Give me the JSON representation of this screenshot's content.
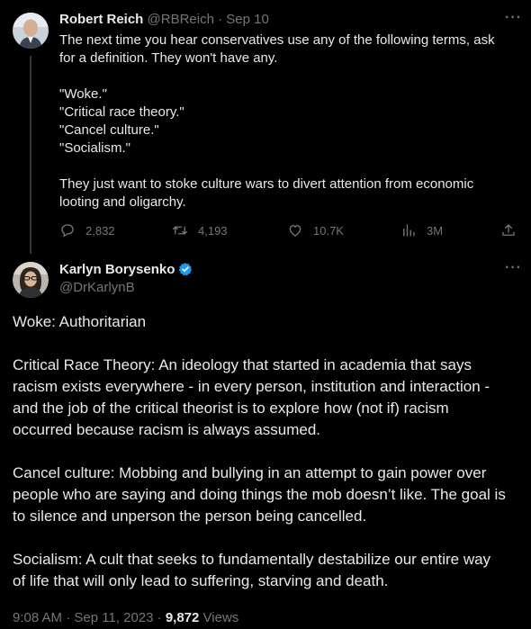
{
  "tweet1": {
    "name": "Robert Reich",
    "handle": "@RBReich",
    "separator": "·",
    "date": "Sep 10",
    "more": "···",
    "text_lines": [
      "The next time you hear conservatives use any of the following terms, ask",
      "for a definition. They won't have any.",
      "",
      "\"Woke.\"",
      "\"Critical race theory.\"",
      "\"Cancel culture.\"",
      "\"Socialism.\"",
      "",
      "They just want to stoke culture wars to divert attention from economic",
      "looting and oligarchy."
    ],
    "replies": "2,832",
    "retweets": "4,193",
    "likes": "10.7K",
    "views": "3M"
  },
  "tweet2": {
    "name": "Karlyn Borysenko",
    "handle": "@DrKarlynB",
    "more": "···",
    "paragraphs": [
      [
        "Woke: Authoritarian"
      ],
      [
        "Critical Race Theory: An ideology that started in academia that says",
        "racism exists everywhere - in every person, institution and interaction -",
        "and the job of the critical theorist is to explore how (not if) racism",
        "occurred because racism is always assumed."
      ],
      [
        "Cancel culture: Mobbing and bullying in an attempt to gain power over",
        "people who are saying and doing things the mob doesn’t like. The goal is",
        "to silence and unperson the person being cancelled."
      ],
      [
        "Socialism: A cult that seeks to fundamentally destabilize our entire way",
        "of life that will only lead to suffering, starving and death."
      ]
    ],
    "timestamp": "9:08 AM · Sep 11, 2023 · ",
    "views_count": "9,872",
    "views_label": "Views"
  },
  "colors": {
    "background": "#000000",
    "text": "#e7e9ea",
    "muted": "#71767b",
    "verified": "#1d9bf0",
    "thread_line": "#333639"
  },
  "icons": [
    "reply-icon",
    "retweet-icon",
    "like-icon",
    "views-icon",
    "share-icon",
    "verified-badge-icon",
    "more-icon"
  ]
}
